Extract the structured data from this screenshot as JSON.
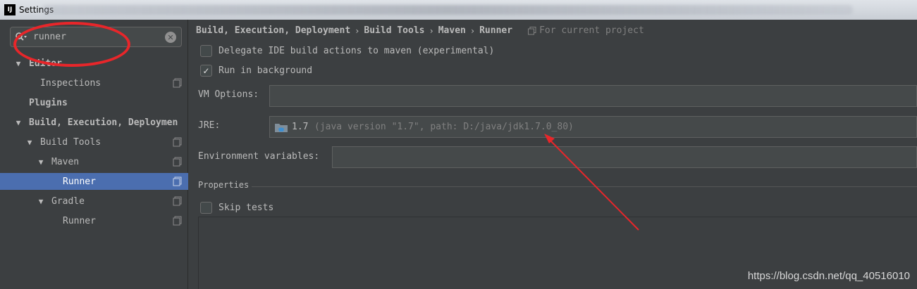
{
  "window": {
    "title": "Settings",
    "logo_text": "IJ"
  },
  "search": {
    "value": "runner"
  },
  "sidebar": {
    "items": [
      {
        "label": "Editor",
        "arrow": "▼"
      },
      {
        "label": "Inspections"
      },
      {
        "label": "Plugins"
      },
      {
        "label": "Build, Execution, Deploymen",
        "arrow": "▼"
      },
      {
        "label": "Build Tools",
        "arrow": "▼"
      },
      {
        "label": "Maven",
        "arrow": "▼"
      },
      {
        "label": "Runner"
      },
      {
        "label": "Gradle",
        "arrow": "▼"
      },
      {
        "label": "Runner"
      }
    ]
  },
  "breadcrumb": {
    "items": [
      "Build, Execution, Deployment",
      "Build Tools",
      "Maven",
      "Runner"
    ],
    "separator": "›",
    "scope": "For current project"
  },
  "options": {
    "delegate_label": "Delegate IDE build actions to maven (experimental)",
    "delegate_checked": false,
    "background_label": "Run in background",
    "background_checked": true,
    "vm_label": "VM Options:",
    "vm_value": "",
    "jre_label": "JRE:",
    "jre_version": "1.7",
    "jre_detail": "(java version \"1.7\", path: D:/java/jdk1.7.0_80)",
    "env_label": "Environment variables:",
    "env_value": "",
    "properties_label": "Properties",
    "skip_tests_label": "Skip tests",
    "skip_tests_checked": false
  },
  "watermark": "https://blog.csdn.net/qq_40516010",
  "colors": {
    "selected": "#4b6eaf",
    "annotation": "#e8262a",
    "background": "#3c3f41"
  },
  "icons": [
    "app-logo",
    "search-icon",
    "clear-icon",
    "copy-icon",
    "scope-icon",
    "folder-icon",
    "check-icon"
  ]
}
